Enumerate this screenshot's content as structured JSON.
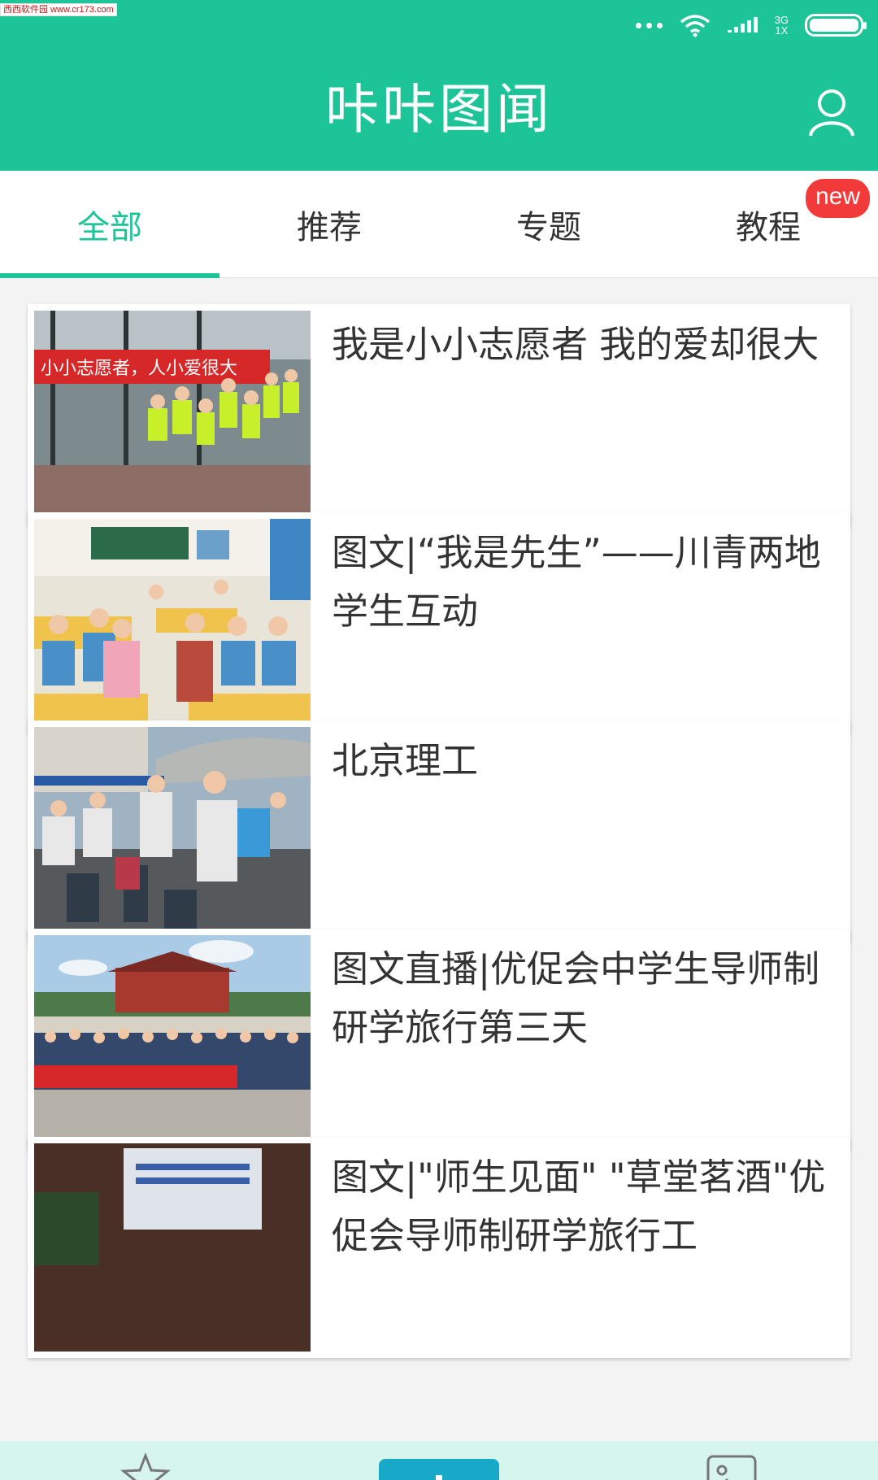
{
  "watermark": "西西软件园 www.cr173.com",
  "status": {
    "network_top": "3G",
    "network_bottom": "1X"
  },
  "header": {
    "title": "咔咔图闻",
    "user_icon": "user-icon"
  },
  "tabs": [
    {
      "label": "全部",
      "active": true
    },
    {
      "label": "推荐"
    },
    {
      "label": "专题"
    },
    {
      "label": "教程",
      "badge": "new"
    }
  ],
  "feed": [
    {
      "title": "我是小小志愿者 我的爱却很大",
      "banner": "小小志愿者，人小爱很大"
    },
    {
      "title": "图文|“我是先生”——川青两地学生互动"
    },
    {
      "title": "北京理工"
    },
    {
      "title": "图文直播|优促会中学生导师制研学旅行第三天"
    },
    {
      "title": "图文|\"师生见面\" \"草堂茗酒\"优促会导师制研学旅行工"
    }
  ],
  "bottom_nav": {
    "left_icon": "star-icon",
    "center_icon": "plus-icon",
    "right_icon": "gallery-icon"
  },
  "colors": {
    "brand": "#1cc497",
    "badge": "#f23a3a",
    "text": "#333333"
  }
}
